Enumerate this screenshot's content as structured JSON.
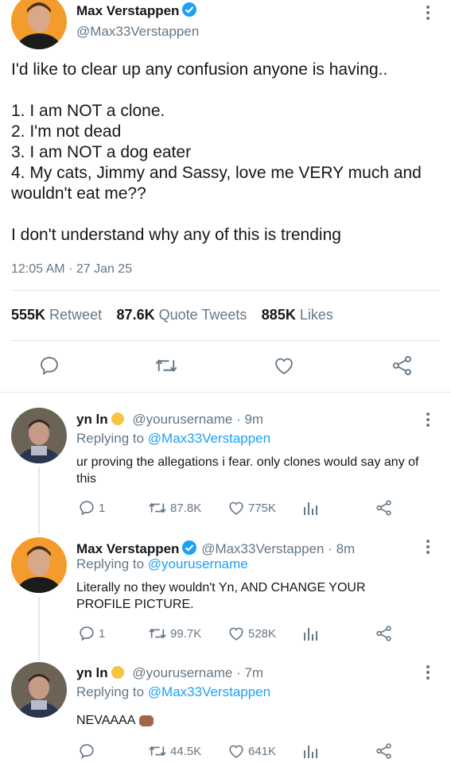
{
  "main_tweet": {
    "author_name": "Max Verstappen",
    "author_handle": "@Max33Verstappen",
    "text": "I'd like to clear up any confusion anyone is having..\n\n1. I am NOT a clone.\n2. I'm not dead\n3. I am NOT a dog eater\n4. My cats, Jimmy and Sassy, love me VERY much and wouldn't eat me??\n\nI don't understand why any of this is trending",
    "timestamp": "12:05 AM · 27 Jan 25",
    "retweets_count": "555K",
    "retweets_label": "Retweet",
    "quotes_count": "87.6K",
    "quotes_label": "Quote Tweets",
    "likes_count": "885K",
    "likes_label": "Likes"
  },
  "replies": [
    {
      "author_name": "yn ln",
      "author_handle": "@yourusername",
      "time": "· 9m",
      "replying_label": "Replying to",
      "replying_handle": "@Max33Verstappen",
      "text": "ur proving the allegations i fear. only clones would say any of this",
      "reply_count": "1",
      "retweet_count": "87.8K",
      "like_count": "775K",
      "emoji": "pensive-face"
    },
    {
      "author_name": "Max Verstappen",
      "author_handle": "@Max33Verstappen",
      "time": "· 8m",
      "replying_label": "Replying to",
      "replying_handle": "@yourusername",
      "text": "Literally no they wouldn't Yn, AND CHANGE YOUR PROFILE PICTURE.",
      "reply_count": "1",
      "retweet_count": "99.7K",
      "like_count": "528K"
    },
    {
      "author_name": "yn ln",
      "author_handle": "@yourusername",
      "time": "· 7m",
      "replying_label": "Replying to",
      "replying_handle": "@Max33Verstappen",
      "text": "NEVAAAA",
      "reply_count": "",
      "retweet_count": "44.5K",
      "like_count": "641K",
      "emoji": "fist-emoji"
    }
  ],
  "colors": {
    "accent": "#1da1f2",
    "muted": "#657786",
    "divider": "#e1e8ed"
  }
}
